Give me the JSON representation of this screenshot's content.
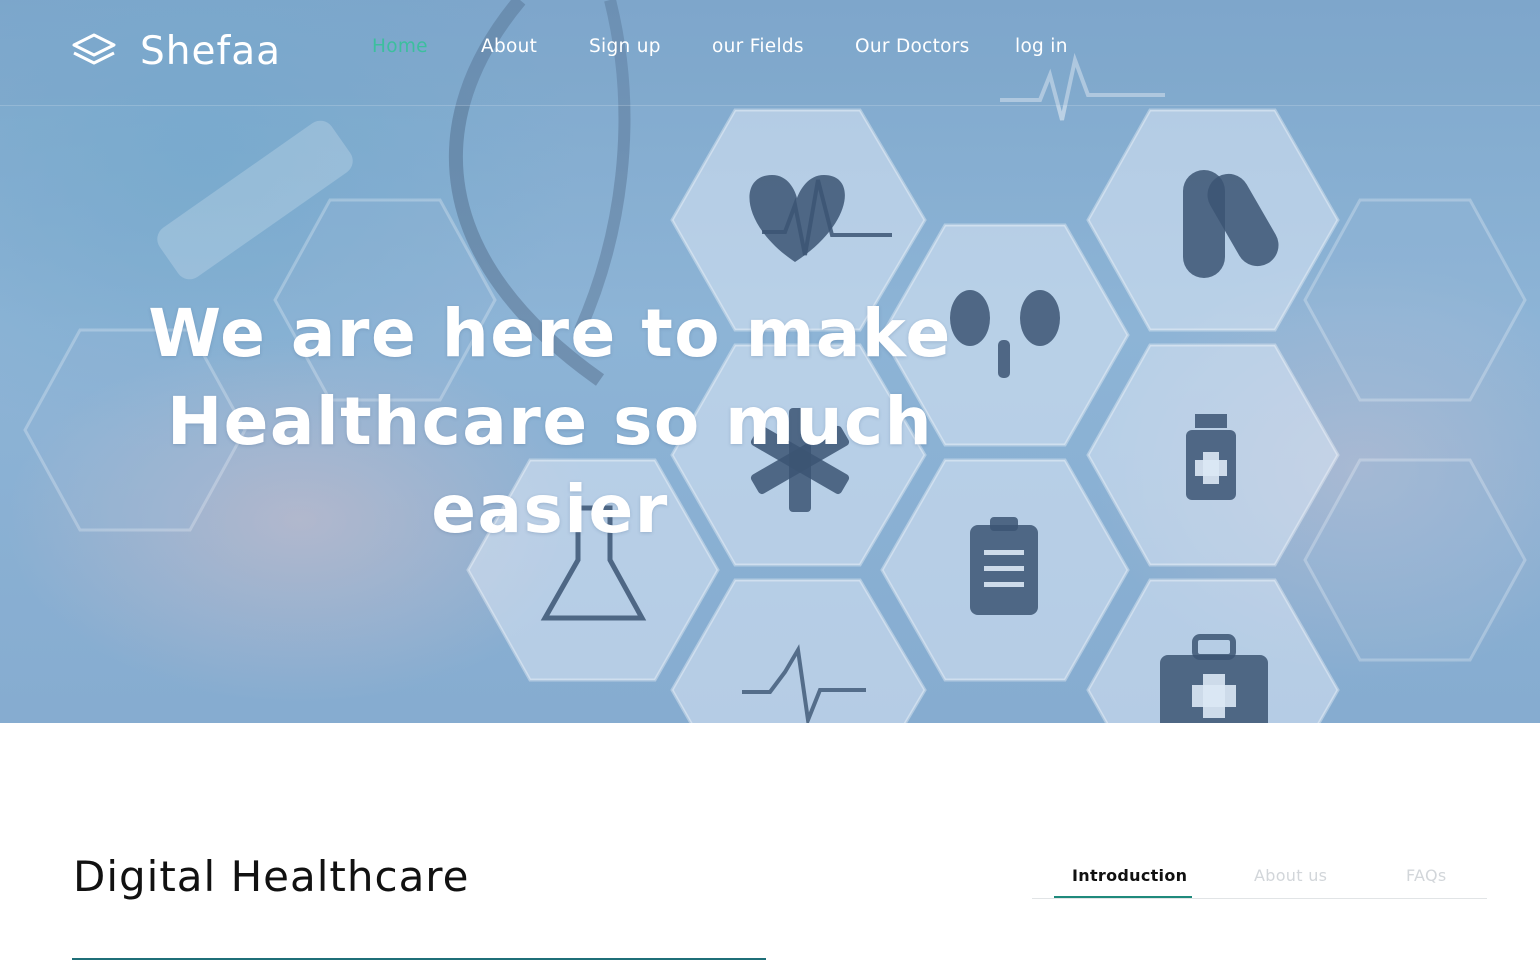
{
  "brand": {
    "name": "Shefaa",
    "icon": "layers-icon"
  },
  "nav": {
    "items": [
      {
        "label": "Home",
        "active": true
      },
      {
        "label": "About"
      },
      {
        "label": "Sign up"
      },
      {
        "label": "our Fields"
      },
      {
        "label": "Our Doctors"
      },
      {
        "label": "log in"
      }
    ]
  },
  "hero": {
    "headline_line1": "We are here to make",
    "headline_line2": "Healthcare so much easier"
  },
  "section": {
    "title": "Digital Healthcare"
  },
  "tabs": [
    {
      "label": "Introduction",
      "active": true
    },
    {
      "label": "About us"
    },
    {
      "label": "FAQs"
    }
  ],
  "colors": {
    "accent": "#3cbf9e",
    "rule": "#1f6f78",
    "tab_underline": "#1f8a7c",
    "hero_tint": "#86acd0"
  }
}
